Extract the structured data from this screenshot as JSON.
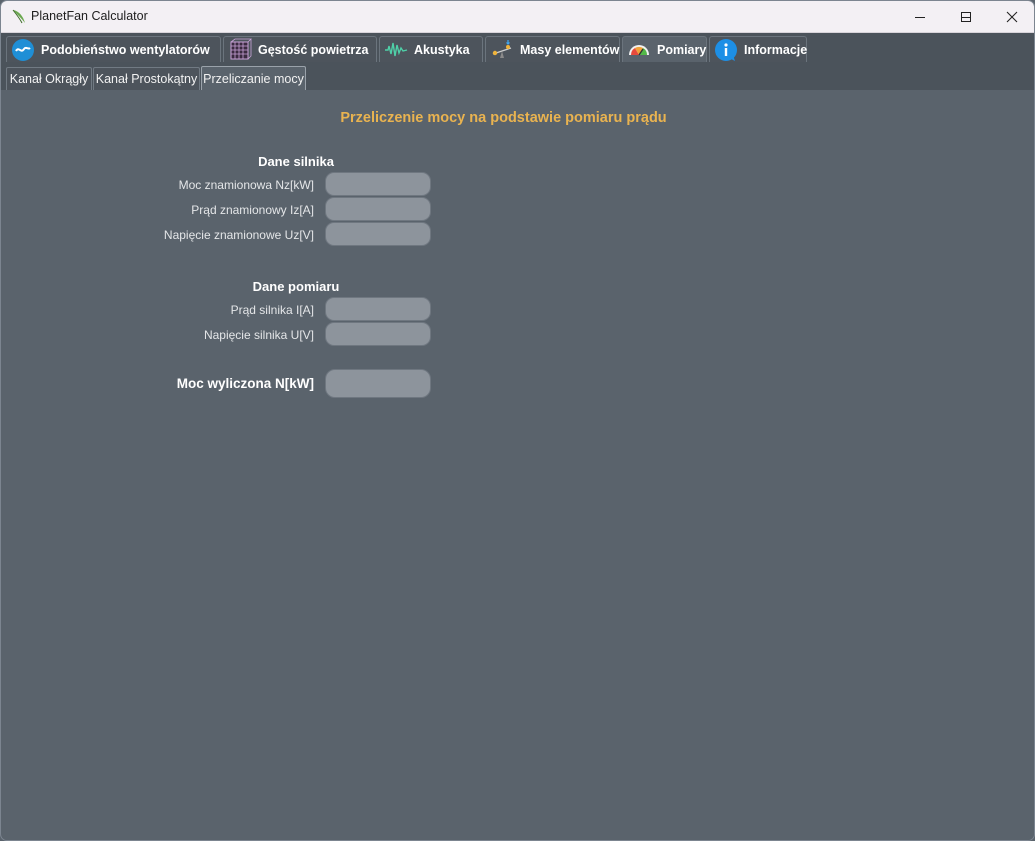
{
  "window": {
    "title": "PlanetFan Calculator"
  },
  "main_tabs": [
    {
      "label": "Podobieństwo wentylatorów",
      "icon": "similarity-icon"
    },
    {
      "label": "Gęstość powietrza",
      "icon": "air-density-icon"
    },
    {
      "label": "Akustyka",
      "icon": "acoustics-wave-icon"
    },
    {
      "label": "Masy elementów",
      "icon": "mass-scale-icon"
    },
    {
      "label": "Pomiary",
      "icon": "gauge-icon"
    },
    {
      "label": "Informacje",
      "icon": "info-icon"
    }
  ],
  "sub_tabs": [
    {
      "label": "Kanał Okrągły"
    },
    {
      "label": "Kanał Prostokątny"
    },
    {
      "label": "Przeliczanie mocy"
    }
  ],
  "active_sub_tab": "Przeliczanie mocy",
  "form": {
    "title": "Przeliczenie mocy na podstawie pomiaru prądu",
    "motor_section": {
      "heading": "Dane silnika",
      "fields": [
        {
          "label": "Moc znamionowa Nz[kW]",
          "value": ""
        },
        {
          "label": "Prąd znamionowy Iz[A]",
          "value": ""
        },
        {
          "label": "Napięcie znamionowe Uz[V]",
          "value": ""
        }
      ]
    },
    "measurement_section": {
      "heading": "Dane pomiaru",
      "fields": [
        {
          "label": "Prąd silnika I[A]",
          "value": ""
        },
        {
          "label": "Napięcie silnika U[V]",
          "value": ""
        }
      ]
    },
    "result": {
      "label": "Moc wyliczona N[kW]",
      "value": ""
    }
  },
  "colors": {
    "background": "#5a636c",
    "title_accent": "#e9b350",
    "field_fill": "#8d949c"
  }
}
